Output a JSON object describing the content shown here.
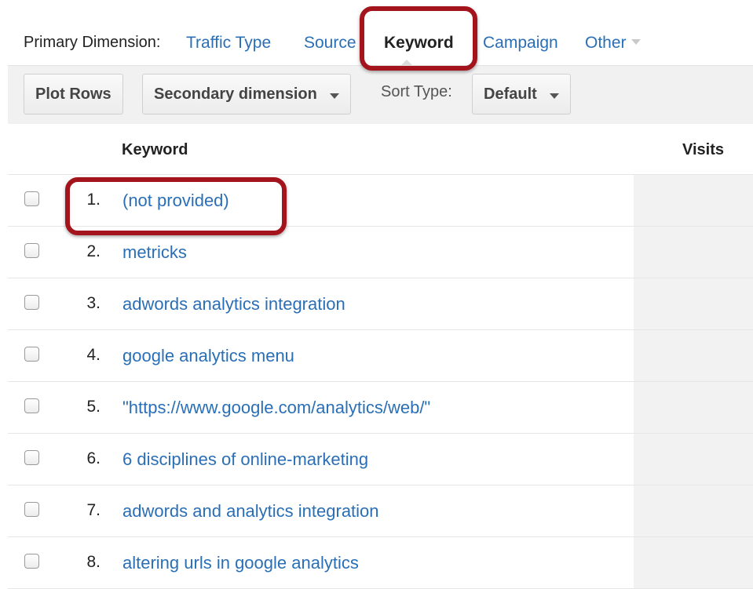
{
  "dimension_bar": {
    "label": "Primary Dimension:",
    "options": [
      {
        "label": "Traffic Type",
        "active": false
      },
      {
        "label": "Source",
        "active": false
      },
      {
        "label": "Keyword",
        "active": true
      },
      {
        "label": "Campaign",
        "active": false
      },
      {
        "label": "Other",
        "active": false
      }
    ]
  },
  "toolbar": {
    "plot_rows": "Plot Rows",
    "secondary_dimension": "Secondary dimension",
    "sort_type_label": "Sort Type:",
    "sort_type_value": "Default"
  },
  "table": {
    "columns": [
      "Keyword",
      "Visits"
    ],
    "rows": [
      {
        "num": "1.",
        "keyword": "(not provided)"
      },
      {
        "num": "2.",
        "keyword": "metricks"
      },
      {
        "num": "3.",
        "keyword": "adwords analytics integration"
      },
      {
        "num": "4.",
        "keyword": "google analytics menu"
      },
      {
        "num": "5.",
        "keyword": "\"https://www.google.com/analytics/web/\""
      },
      {
        "num": "6.",
        "keyword": "6 disciplines of online-marketing"
      },
      {
        "num": "7.",
        "keyword": "adwords and analytics integration"
      },
      {
        "num": "8.",
        "keyword": "altering urls in google analytics"
      }
    ]
  },
  "colors": {
    "link": "#2a6fb6",
    "highlight": "#a3141c",
    "toolbar_bg": "#f1f1f1"
  }
}
